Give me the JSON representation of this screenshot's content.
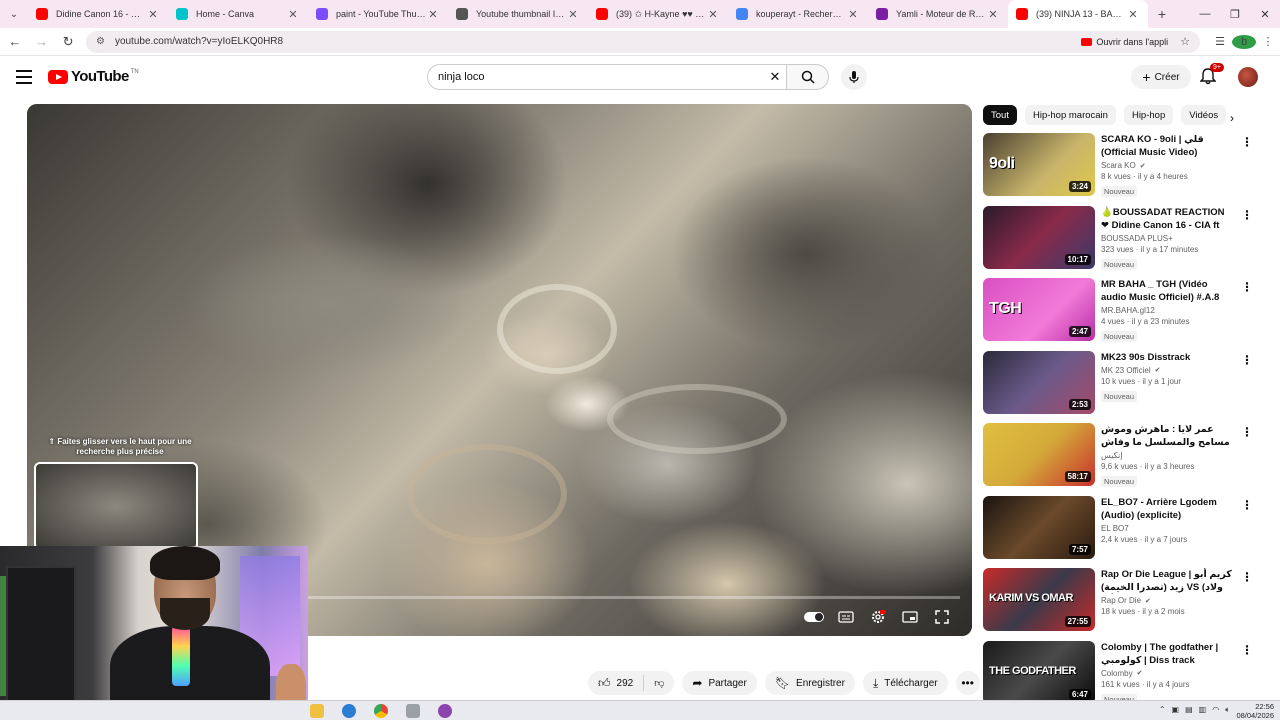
{
  "browser": {
    "tabs": [
      {
        "title": "Didine Canon 16 - CIA ft M",
        "favicon_color": "#ff0000"
      },
      {
        "title": "Home - Canva",
        "favicon_color": "#00c4cc"
      },
      {
        "title": "paint - YouTube Thumbnail",
        "favicon_color": "#7c4dff"
      },
      {
        "title": "Youtube thumbnail Image",
        "favicon_color": "#555555"
      },
      {
        "title": "(39) ✩ H-Kayne ♥♥ kolna",
        "favicon_color": "#ff0000"
      },
      {
        "title": "kouperayt - Recherche Go",
        "favicon_color": "#4285f4"
      },
      {
        "title": "Yamli - Moteur de Recherc",
        "favicon_color": "#7b1fa2"
      },
      {
        "title": "(39) NINJA 13 - BANG BA",
        "favicon_color": "#ff0000"
      }
    ],
    "active_tab_index": 7,
    "url": "youtube.com/watch?v=yIoELKQ0HR8",
    "open_in_app_label": "Ouvrir dans l'appli",
    "profile_initial": "b"
  },
  "masthead": {
    "logo_text": "YouTube",
    "country_code": "TN",
    "search_query": "ninja loco",
    "create_label": "Créer",
    "notifications_badge": "9+"
  },
  "player": {
    "hint_text": "⇑ Faites glisser vers le haut pour une recherche plus précise",
    "progress_fraction": 0.0
  },
  "actions": {
    "like_count": "292",
    "share_label": "Partager",
    "save_label": "Enregistrer",
    "download_label": "Télécharger"
  },
  "chips": [
    "Tout",
    "Hip-hop marocain",
    "Hip-hop",
    "Vidéos"
  ],
  "recommendations": [
    {
      "title": "SCARA KO - 9oli | قلي (Official Music Video)",
      "channel": "Scara KO",
      "verified": true,
      "stats": "8 k vues · il y a 4 heures",
      "badge": "Nouveau",
      "duration": "3:24",
      "thumb_bg": "linear-gradient(135deg,#4a4032,#c8b56a 60%,#e0c84a)",
      "thumb_text": "9oli"
    },
    {
      "title": "🍐BOUSSADAT REACTION ❤ Didine Canon 16 - CIA ft Mc ...",
      "channel": "BOUSSADA PLUS+",
      "verified": false,
      "stats": "323 vues · il y a 17 minutes",
      "badge": "Nouveau",
      "duration": "10:17",
      "thumb_bg": "linear-gradient(135deg,#2a1a2a,#8a2a4a 50%,#3a3a6a)",
      "thumb_text": ""
    },
    {
      "title": "MR BAHA _ TGH (Vidéo audio Music Officiel) #.A.8",
      "channel": "MR.BAHA.gl12",
      "verified": false,
      "stats": "4 vues · il y a 23 minutes",
      "badge": "Nouveau",
      "duration": "2:47",
      "thumb_bg": "linear-gradient(135deg,#d94fc2,#f27ad8 60%,#b82fa6)",
      "thumb_text": "TGH"
    },
    {
      "title": "MK23 90s Disstrack",
      "channel": "MK 23 Officiel",
      "verified": true,
      "stats": "10 k vues · il y a 1 jour",
      "badge": "Nouveau",
      "duration": "2:53",
      "thumb_bg": "linear-gradient(135deg,#2a2a3a,#6a5a8a 50%,#a54a6a)",
      "thumb_text": ""
    },
    {
      "title": "عمر لايا : ماهرش وموش مسامح والمسلسل ما وفاش",
      "channel": "إنكيس",
      "verified": false,
      "stats": "9,6 k vues · il y a 3 heures",
      "badge": "Nouveau",
      "duration": "58:17",
      "thumb_bg": "linear-gradient(135deg,#e0c040,#d4a93a 50%,#c9302c)",
      "thumb_text": ""
    },
    {
      "title": "EL_BO7 - Arrière Lgodem (Audio) (explicite)",
      "channel": "EL BO7",
      "verified": false,
      "stats": "2,4 k vues · il y a 7 jours",
      "badge": "",
      "duration": "7:57",
      "thumb_bg": "linear-gradient(135deg,#1a1410,#6a4a2a 50%,#2a1a10)",
      "thumb_text": ""
    },
    {
      "title": "Rap Or Die League | كريم أبو زيد (تصدرا الخيمة) VS (ولاد أبو) عمر طابع ...",
      "channel": "Rap Or Die",
      "verified": true,
      "stats": "18 k vues · il y a 2 mois",
      "badge": "",
      "duration": "27:55",
      "thumb_bg": "linear-gradient(135deg,#c92a2a,#3a3a4a 50%,#c92a2a)",
      "thumb_text": "KARIM VS OMAR"
    },
    {
      "title": "Colomby | The godfather | كولومبي | Diss track",
      "channel": "Colomby",
      "verified": true,
      "stats": "161 k vues · il y a 4 jours",
      "badge": "Nouveau",
      "duration": "6:47",
      "thumb_bg": "linear-gradient(135deg,#1a1a1a,#4a4a4a 50%,#0a0a0a)",
      "thumb_text": "THE GODFATHER"
    }
  ],
  "taskbar": {
    "time": "22:56",
    "date": "08/04/2026"
  }
}
